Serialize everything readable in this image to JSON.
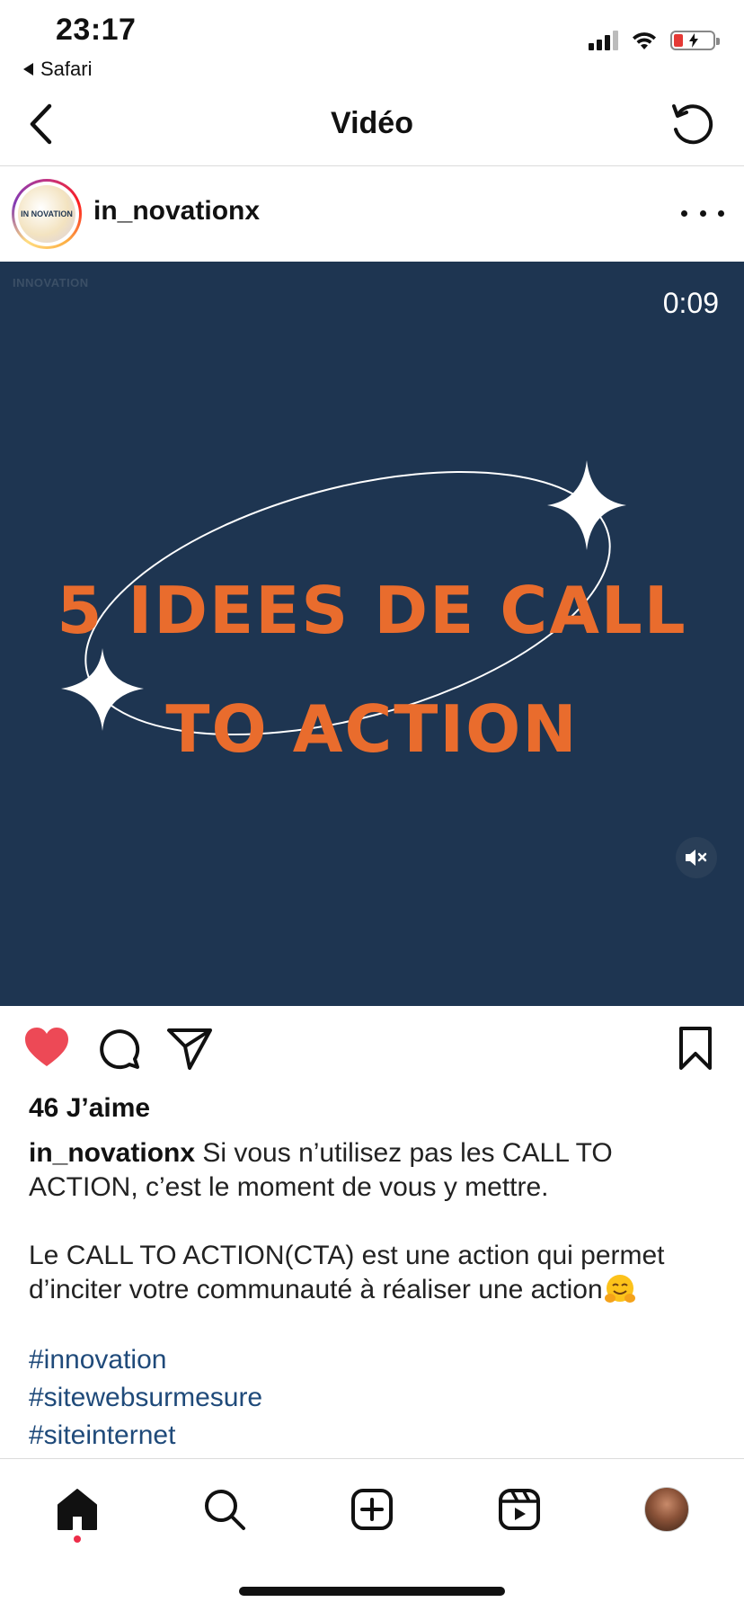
{
  "status_bar": {
    "time": "23:17",
    "back_app": "Safari"
  },
  "nav": {
    "title": "Vidéo"
  },
  "post": {
    "username": "in_novationx",
    "avatar_text": "IN NOVATION",
    "video": {
      "logo_text": "INNOVATION",
      "timer": "0:09",
      "headline_line1": "5 IDEES DE CALL",
      "headline_line2": "TO ACTION",
      "background_color": "#1e3551",
      "headline_color": "#e96c2d"
    },
    "likes": "46 J’aime",
    "caption": {
      "username": "in_novationx",
      "line1": " Si vous n’utilisez pas les CALL TO ACTION, c’est le moment de vous y mettre.",
      "line2": "Le CALL TO ACTION(CTA) est une action qui permet d’inciter votre communauté à réaliser une action",
      "hashtags": [
        "#innovation",
        "#sitewebsurmesure",
        "#siteinternet"
      ]
    }
  },
  "icons": {
    "like": "heart-filled-icon",
    "comment": "comment-icon",
    "share": "send-icon",
    "save": "bookmark-icon",
    "mute": "speaker-muted-icon"
  },
  "colors": {
    "like": "#ed4956",
    "hashtag": "#1f4a7a",
    "notification_dot": "#ed2d49"
  }
}
